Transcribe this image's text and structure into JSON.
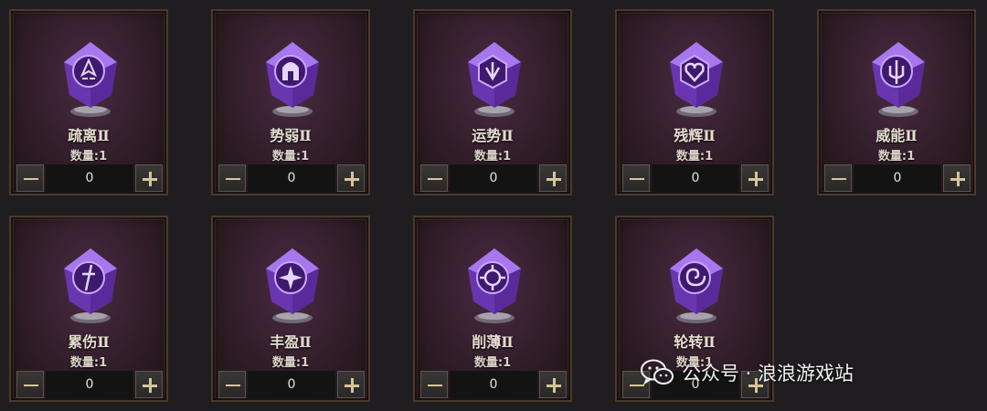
{
  "items": [
    {
      "name": "疏离Ⅱ",
      "qty_label": "数量:1",
      "value": "0",
      "icon": "rune-split-icon"
    },
    {
      "name": "势弱Ⅱ",
      "qty_label": "数量:1",
      "value": "0",
      "icon": "helmet-icon"
    },
    {
      "name": "运势Ⅱ",
      "qty_label": "数量:1",
      "value": "0",
      "icon": "hexagon-arrow-icon"
    },
    {
      "name": "残辉Ⅱ",
      "qty_label": "数量:1",
      "value": "0",
      "icon": "heart-icon"
    },
    {
      "name": "威能Ⅱ",
      "qty_label": "数量:1",
      "value": "0",
      "icon": "trident-icon"
    },
    {
      "name": "累伤Ⅱ",
      "qty_label": "数量:1",
      "value": "0",
      "icon": "dagger-icon"
    },
    {
      "name": "丰盈Ⅱ",
      "qty_label": "数量:1",
      "value": "0",
      "icon": "four-point-star-icon"
    },
    {
      "name": "削薄Ⅱ",
      "qty_label": "数量:1",
      "value": "0",
      "icon": "crosshair-icon"
    },
    {
      "name": "轮转Ⅱ",
      "qty_label": "数量:1",
      "value": "0",
      "icon": "spiral-icon"
    }
  ],
  "watermark": {
    "text": "公众号 · 浪浪游戏站",
    "icon": "wechat-logo-icon"
  },
  "colors": {
    "gem": "#8a52d8",
    "gem_light": "#c8a0ff",
    "frame": "#4a3a2a",
    "accent": "#d8c49a"
  }
}
